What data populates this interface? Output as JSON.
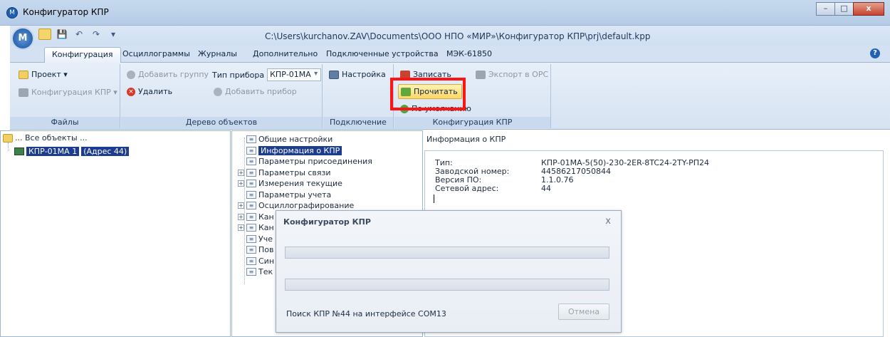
{
  "window": {
    "title": "Конфигуратор КПР",
    "buttons": [
      "–",
      "□",
      "x"
    ]
  },
  "app_orb": "М",
  "path": "C:\\Users\\kurchanov.ZAV\\Documents\\ООО НПО «МИР»\\Конфигуратор КПР\\prj\\default.kpp",
  "tabs": [
    "Конфигурация",
    "Осциллограммы",
    "Журналы",
    "Дополнительно",
    "Подключенные устройства",
    "МЭК-61850"
  ],
  "ribbon": {
    "files": {
      "project": "Проект ▾",
      "config": "Конфигурация КПР ▾",
      "label": "Файлы"
    },
    "tree": {
      "add_group": "Добавить группу",
      "device_type_label": "Тип прибора",
      "device_type_value": "КПР-01МА",
      "delete": "Удалить",
      "add_device": "Добавить прибор",
      "label": "Дерево объектов"
    },
    "connection": {
      "settings": "Настройка",
      "label": "Подключение"
    },
    "kpr": {
      "write": "Записать",
      "export": "Экспорт в OPC",
      "read": "Прочитать",
      "default": "По умолчанию",
      "label": "Конфигурация КПР"
    }
  },
  "left_tree": {
    "root": "... Все объекты ...",
    "device": "КПР-01МА 1",
    "address": "(Адрес 44)"
  },
  "settings_tree": [
    "Общие настройки",
    "Информация о КПР",
    "Параметры присоединения",
    "Параметры связи",
    "Измерения текущие",
    "Параметры учета",
    "Осциллографирование",
    "Кан",
    "Кан",
    "Уче",
    "Пов",
    "Син",
    "Тек"
  ],
  "info": {
    "title": "Информация о КПР",
    "rows": [
      {
        "k": "Тип:",
        "v": "КПР-01МА-5(50)-230-2ER-8TC24-2TY-РП24"
      },
      {
        "k": "Заводской номер:",
        "v": "44586217050844"
      },
      {
        "k": "Версия ПО:",
        "v": "1.1.0.76"
      },
      {
        "k": "Сетевой адрес:",
        "v": "44"
      }
    ]
  },
  "dialog": {
    "title": "Конфигуратор КПР",
    "close": "x",
    "status": "Поиск КПР №44 на интерфейсе COM13",
    "cancel": "Отмена"
  },
  "colors": {
    "highlight": "#ff1414",
    "selection": "#1c3d8f",
    "ribbon": "#d6e3f2"
  }
}
